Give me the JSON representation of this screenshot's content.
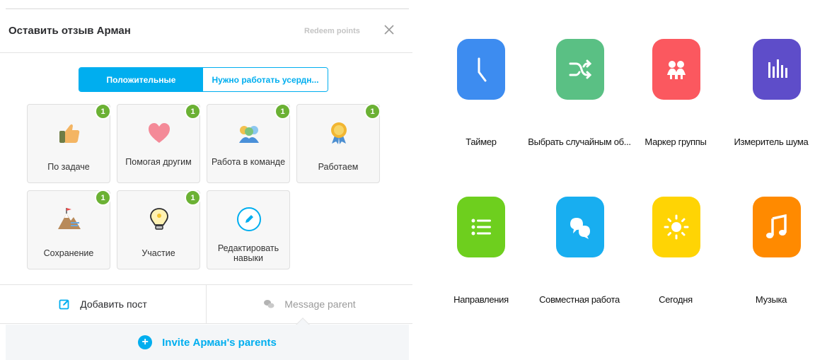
{
  "modal": {
    "title": "Оставить отзыв Арман",
    "redeem": "Redeem points",
    "tabs": {
      "positive": "Положительные",
      "needs_work": "Нужно работать усердн..."
    },
    "skills": [
      {
        "label": "По задаче",
        "count": "1",
        "icon": "thumbs-up-icon"
      },
      {
        "label": "Помогая другим",
        "count": "1",
        "icon": "heart-icon"
      },
      {
        "label": "Работа в команде",
        "count": "1",
        "icon": "team-icon"
      },
      {
        "label": "Работаем",
        "count": "1",
        "icon": "medal-icon"
      },
      {
        "label": "Сохранение",
        "count": "1",
        "icon": "mountain-flag-icon"
      },
      {
        "label": "Участие",
        "count": "1",
        "icon": "lightbulb-icon"
      },
      {
        "label": "Редактировать навыки",
        "count": "",
        "icon": "pencil-icon"
      }
    ],
    "footer": {
      "add_post": "Добавить пост",
      "message_parent": "Message parent"
    },
    "invite": {
      "prefix": "Invite ",
      "name": "Арман",
      "suffix": "'s parents"
    }
  },
  "tools": [
    {
      "label": "Таймер",
      "icon": "clock-hand-icon",
      "color": "#3d8cf0"
    },
    {
      "label": "Выбрать случайным об...",
      "icon": "shuffle-icon",
      "color": "#5ac084"
    },
    {
      "label": "Маркер группы",
      "icon": "group-people-icon",
      "color": "#fb585f"
    },
    {
      "label": "Измеритель шума",
      "icon": "sound-bars-icon",
      "color": "#5e4dc9"
    },
    {
      "label": "Направления",
      "icon": "list-icon",
      "color": "#6ecf1e"
    },
    {
      "label": "Совместная работа",
      "icon": "chat-bubbles-icon",
      "color": "#18aef0"
    },
    {
      "label": "Сегодня",
      "icon": "sun-icon",
      "color": "#ffd404"
    },
    {
      "label": "Музыка",
      "icon": "music-note-icon",
      "color": "#ff8a00"
    }
  ],
  "colors": {
    "accent": "#00aeef",
    "badge": "#6bb134"
  }
}
